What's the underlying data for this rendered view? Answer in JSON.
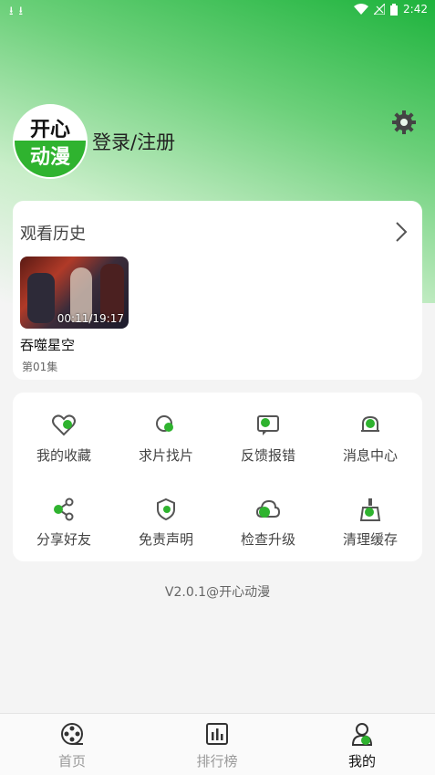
{
  "status": {
    "time": "2:42"
  },
  "profile": {
    "logo_top": "开心",
    "logo_bottom": "动漫",
    "login_text": "登录/注册"
  },
  "history": {
    "title": "观看历史",
    "item": {
      "title": "吞噬星空",
      "episode": "第01集",
      "progress": "00:11/19:17"
    }
  },
  "menu": [
    {
      "label": "我的收藏",
      "icon": "heart-icon"
    },
    {
      "label": "求片找片",
      "icon": "search-film-icon"
    },
    {
      "label": "反馈报错",
      "icon": "feedback-icon"
    },
    {
      "label": "消息中心",
      "icon": "bell-icon"
    },
    {
      "label": "分享好友",
      "icon": "share-icon"
    },
    {
      "label": "免责声明",
      "icon": "shield-icon"
    },
    {
      "label": "检查升级",
      "icon": "cloud-upload-icon"
    },
    {
      "label": "清理缓存",
      "icon": "broom-icon"
    }
  ],
  "version": "V2.0.1@开心动漫",
  "nav": [
    {
      "label": "首页",
      "icon": "film-reel-icon",
      "active": false
    },
    {
      "label": "排行榜",
      "icon": "chart-icon",
      "active": false
    },
    {
      "label": "我的",
      "icon": "profile-icon",
      "active": true
    }
  ],
  "colors": {
    "accent": "#2fb32f",
    "icon_gray": "#555555"
  }
}
